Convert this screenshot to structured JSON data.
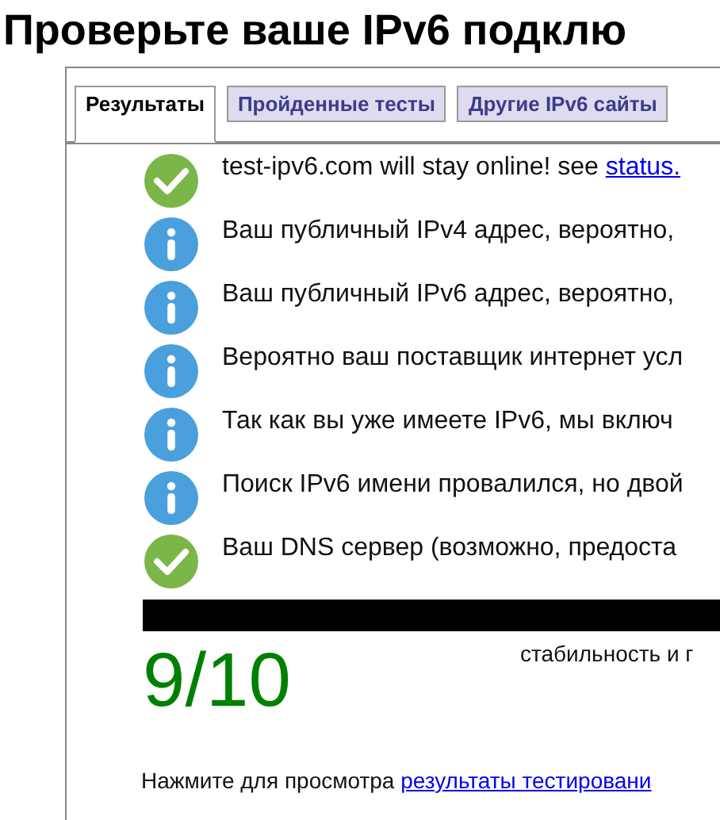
{
  "title": "Проверьте ваше IPv6 подклю",
  "tabs": [
    {
      "label": "Результаты",
      "selected": true
    },
    {
      "label": "Пройденные тесты",
      "selected": false
    },
    {
      "label": "Другие IPv6 сайты",
      "selected": false
    }
  ],
  "results": [
    {
      "kind": "ok",
      "text": "test-ipv6.com will stay online! see ",
      "link": "status."
    },
    {
      "kind": "info",
      "text": "Ваш публичный IPv4 адрес, вероятно,"
    },
    {
      "kind": "info",
      "text": "Ваш публичный IPv6 адрес, вероятно,"
    },
    {
      "kind": "info",
      "text": "Вероятно ваш поставщик интернет усл"
    },
    {
      "kind": "info",
      "text": "Так как вы уже имеете IPv6, мы включ"
    },
    {
      "kind": "info",
      "text": "Поиск IPv6 имени провалился, но двой"
    },
    {
      "kind": "ok",
      "text": "Ваш DNS сервер (возможно, предоста"
    }
  ],
  "score": {
    "value": "9/10",
    "caption": "стабильность и г"
  },
  "footer": {
    "text": "Нажмите для просмотра ",
    "link": "результаты тестировани"
  }
}
